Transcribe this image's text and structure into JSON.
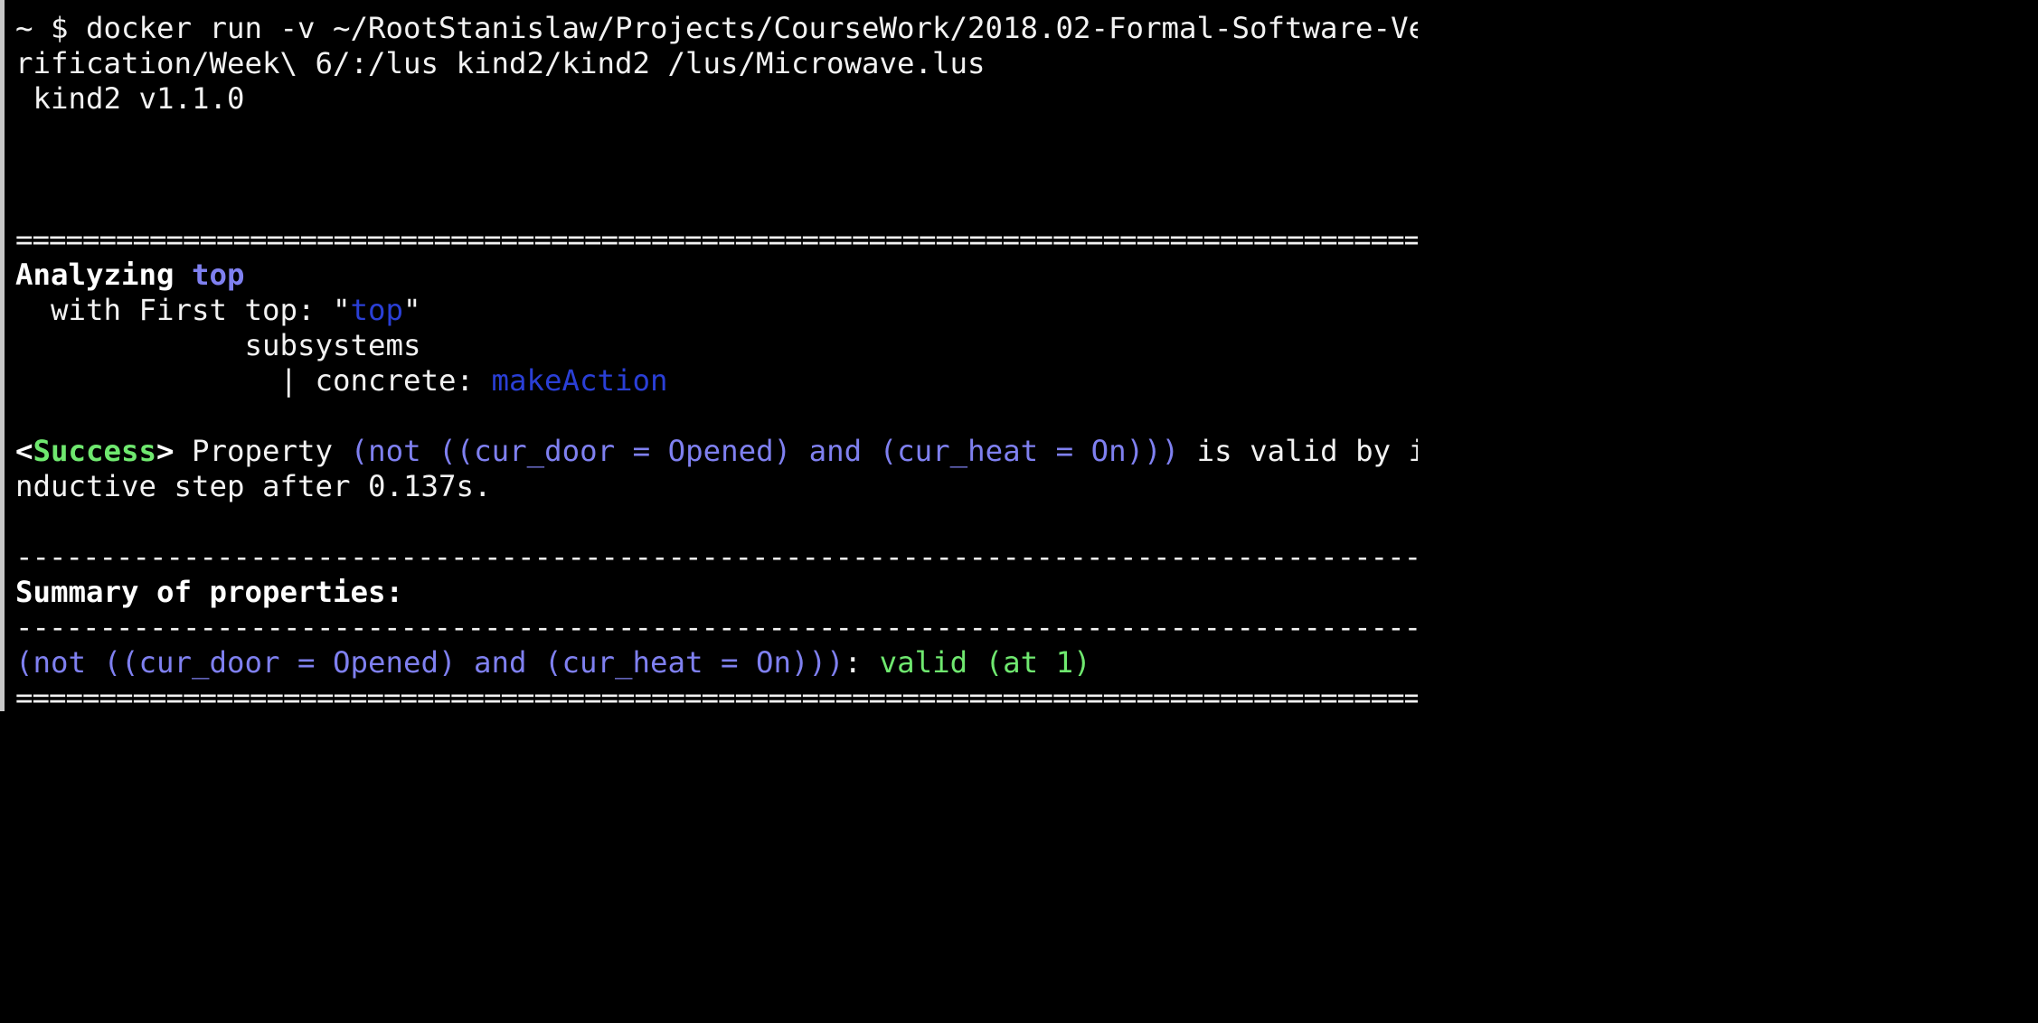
{
  "terminal": {
    "command_line_1": "~ $ docker run -v ~/RootStanislaw/Projects/CourseWork/2018.02-Formal-Software-Ve",
    "command_line_2": "rification/Week\\ 6/:/lus kind2/kind2 /lus/Microwave.lus",
    "version": " kind2 v1.1.0",
    "double_rule": "==============================================================================================================",
    "single_rule": "--------------------------------------------------------------------------------------------------------------",
    "analyzing": {
      "label": "Analyzing ",
      "node": "top",
      "with_prefix": "  with First top: \"",
      "with_node": "top",
      "with_suffix": "\"",
      "subsystems": "             subsystems",
      "concrete_prefix": "               | concrete: ",
      "concrete_node": "makeAction"
    },
    "success": {
      "open_bracket": "<",
      "tag": "Success",
      "close_bracket": ">",
      "property_word": " Property ",
      "property_expr": "(not ((cur_door = Opened) and (cur_heat = On)))",
      "result_text": " is valid by i",
      "result_text_2": "nductive step after 0.137s."
    },
    "summary": {
      "title": "Summary of properties:",
      "property_expr": "(not ((cur_door = Opened) and (cur_heat = On)))",
      "colon": ": ",
      "status": "valid (at 1)"
    }
  },
  "colors": {
    "background": "#000000",
    "text": "#f2f2f2",
    "node_highlight": "#7f80f0",
    "node_link": "#2a3fd6",
    "success": "#6fe86f"
  }
}
